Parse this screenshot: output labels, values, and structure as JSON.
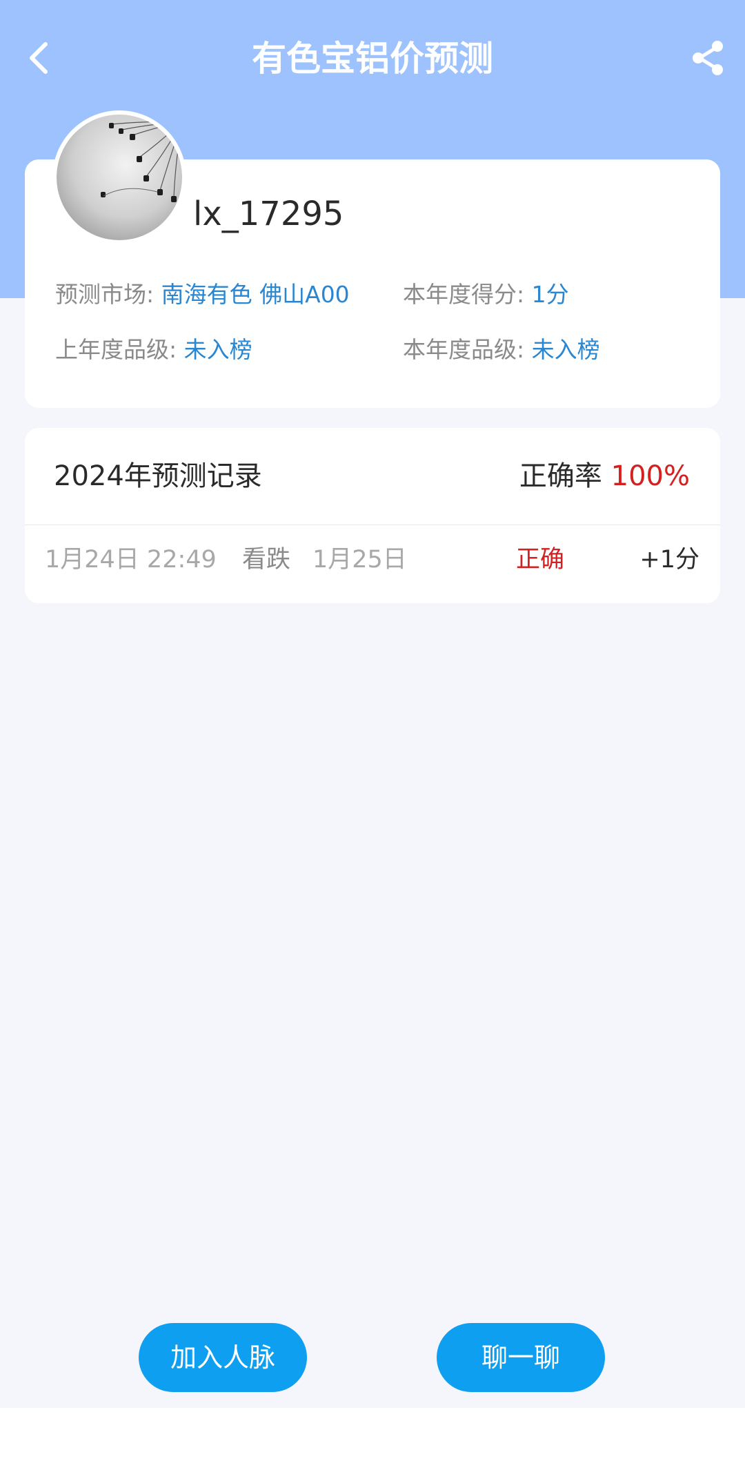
{
  "header": {
    "title": "有色宝铝价预测",
    "background_color": "#9dc2fd",
    "back_icon": "chevron-left-icon",
    "share_icon": "share-icon"
  },
  "profile": {
    "username": "lx_17295",
    "avatar_description": "black and white photo of swing ride",
    "fields": {
      "market_label": "预测市场:",
      "market_value": "南海有色 佛山A00",
      "score_label": "本年度得分:",
      "score_value": "1分",
      "last_year_grade_label": "上年度品级:",
      "last_year_grade_value": "未入榜",
      "this_year_grade_label": "本年度品级:",
      "this_year_grade_value": "未入榜"
    }
  },
  "records": {
    "title": "2024年预测记录",
    "accuracy_label": "正确率",
    "accuracy_value": "100%",
    "items": [
      {
        "datetime": "1月24日 22:49",
        "direction": "看跌",
        "target_date": "1月25日",
        "result": "正确",
        "points": "+1分"
      }
    ]
  },
  "actions": {
    "add_contact_label": "加入人脉",
    "chat_label": "聊一聊",
    "button_color": "#0f9ff0"
  },
  "colors": {
    "accent_blue": "#2a86d0",
    "correct_red": "#d32020",
    "muted_gray": "#8a8a8a"
  }
}
